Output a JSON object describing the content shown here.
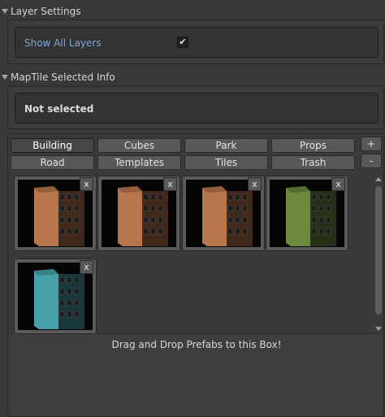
{
  "layer_settings": {
    "title": "Layer Settings",
    "show_all_layers_label": "Show All Layers",
    "show_all_layers_checked": true,
    "check_glyph": "✔"
  },
  "maptile_info": {
    "title": "MapTile Selected Info",
    "status": "Not selected"
  },
  "categories": {
    "selected": "Building",
    "tabs": [
      "Building",
      "Cubes",
      "Park",
      "Props",
      "Road",
      "Templates",
      "Tiles",
      "Trash"
    ],
    "add_label": "+",
    "remove_label": "-"
  },
  "prefabs": [
    {
      "name": "building-orange-1",
      "color": "#b7764c"
    },
    {
      "name": "building-orange-2",
      "color": "#b7764c"
    },
    {
      "name": "building-orange-3",
      "color": "#b7764c"
    },
    {
      "name": "building-green",
      "color": "#6b8a3e"
    },
    {
      "name": "building-teal",
      "color": "#4aa0a8"
    }
  ],
  "tile_close_label": "x",
  "drop_hint": "Drag and Drop Prefabs to this Box!"
}
